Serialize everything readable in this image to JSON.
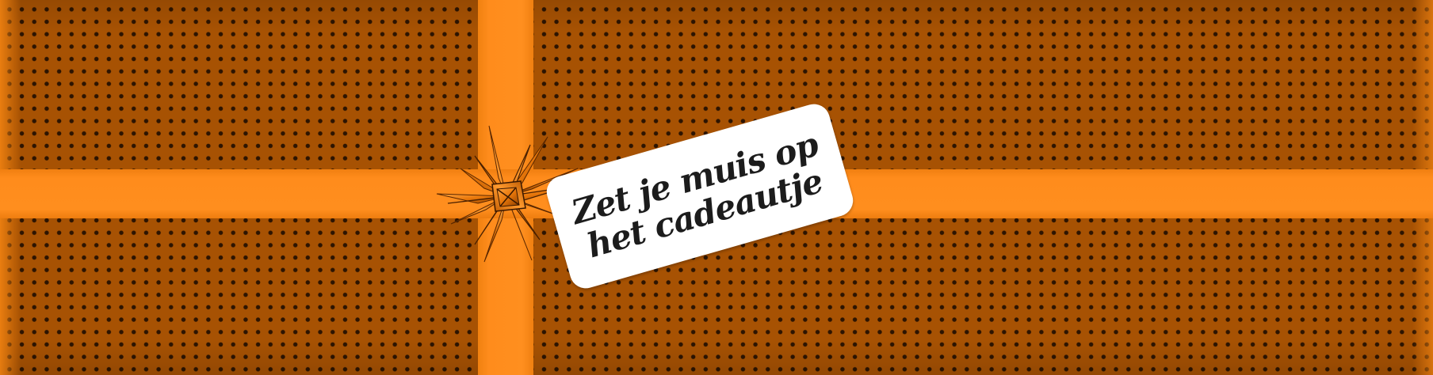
{
  "tag": {
    "line1": "Zet je muis op",
    "line2": "het cadeautje"
  },
  "colors": {
    "paper": "#a75203",
    "dots": "#2c1402",
    "ribbon": "#ff8c1c",
    "tag": "#ffffff",
    "text": "#1c1c1c"
  },
  "icons": {
    "bow": "gift-bow-icon"
  }
}
